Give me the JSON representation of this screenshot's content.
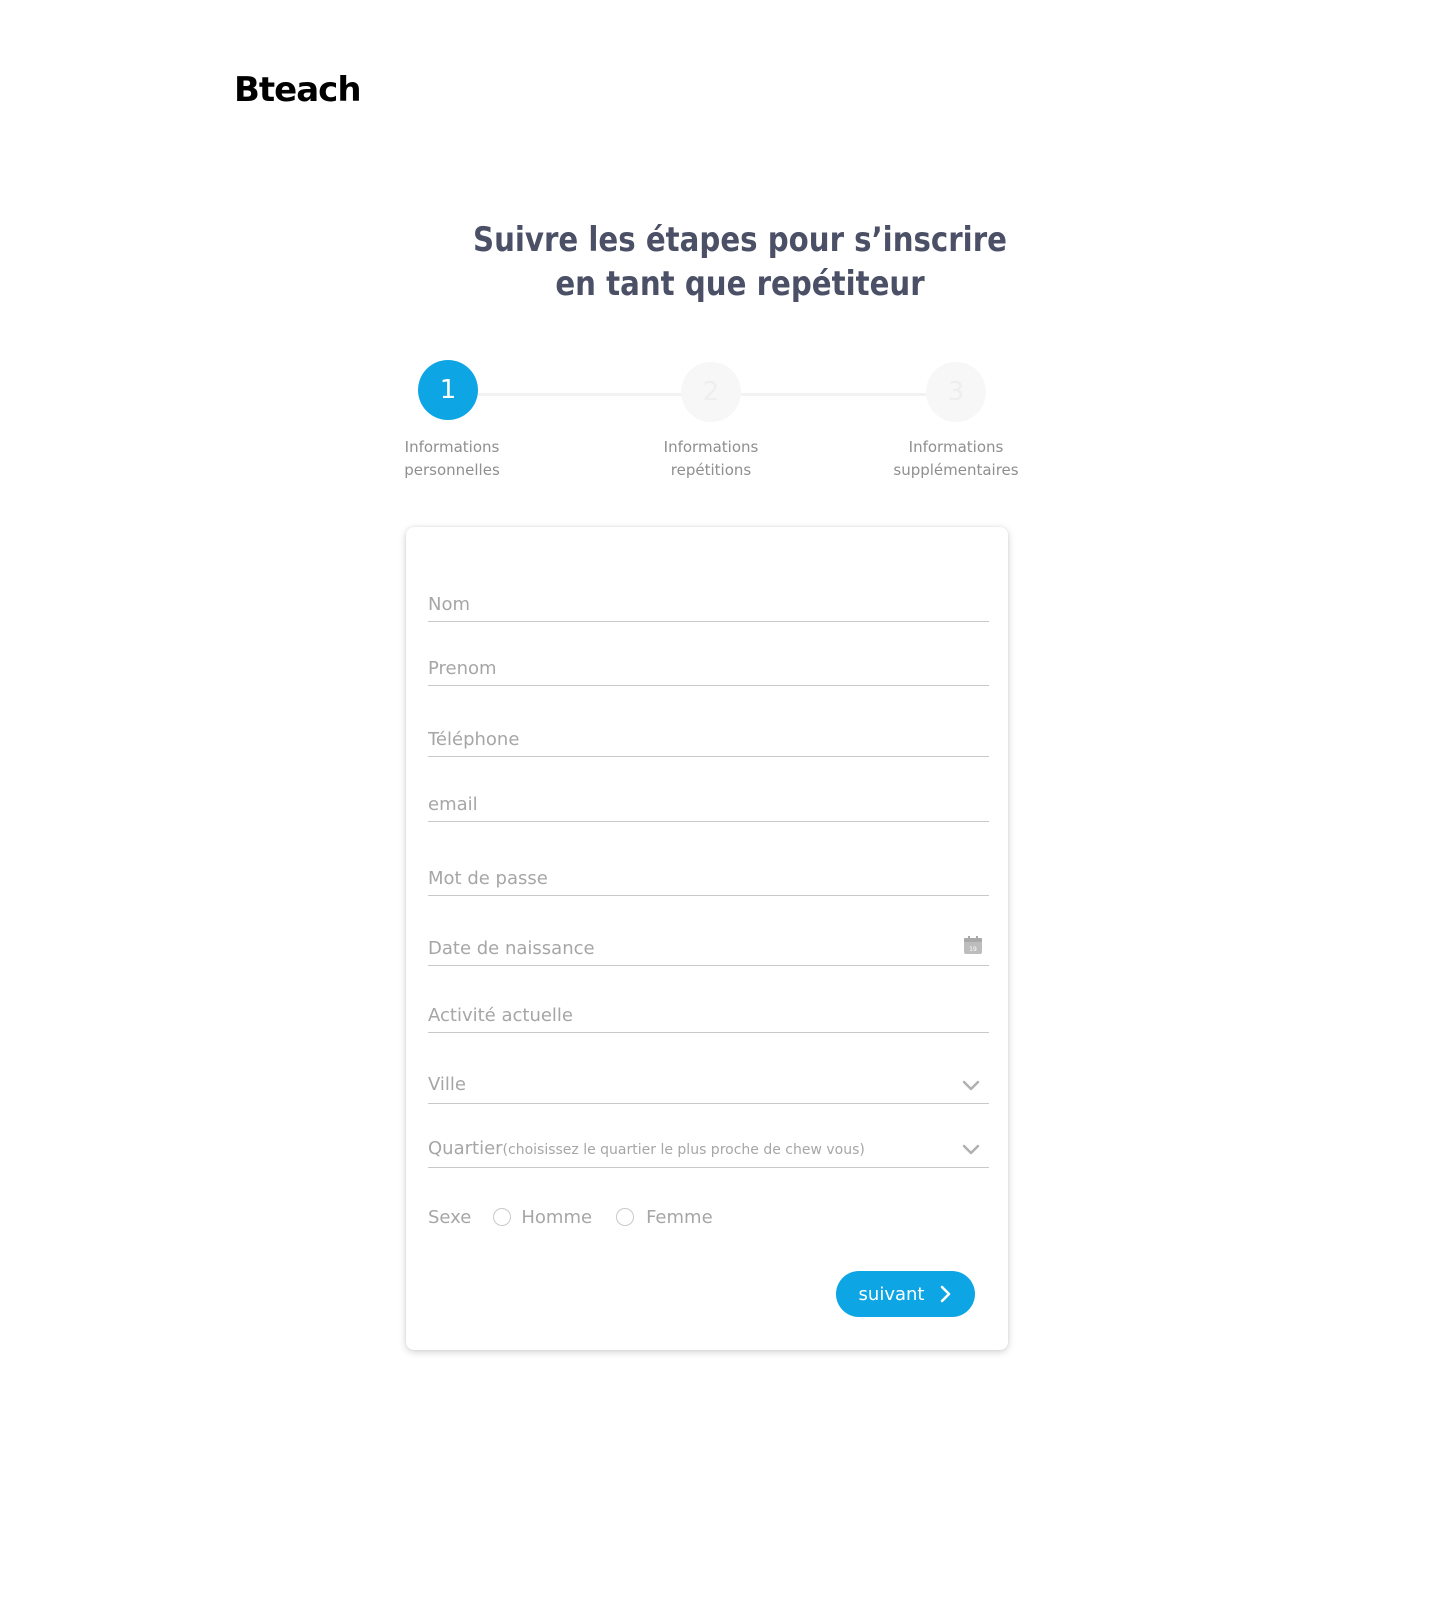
{
  "brand": {
    "logo_text": "Bteach"
  },
  "header": {
    "title_line1": "Suivre les étapes pour s’inscrire",
    "title_line2": "en tant que repétiteur"
  },
  "stepper": {
    "active_step": 1,
    "steps": [
      {
        "number": "1",
        "label_line1": "Informations",
        "label_line2": "personnelles"
      },
      {
        "number": "2",
        "label_line1": "Informations",
        "label_line2": "repétitions"
      },
      {
        "number": "3",
        "label_line1": "Informations",
        "label_line2": "supplémentaires"
      }
    ]
  },
  "form": {
    "nom": {
      "placeholder": "Nom",
      "value": ""
    },
    "prenom": {
      "placeholder": "Prenom",
      "value": ""
    },
    "telephone": {
      "placeholder": "Téléphone",
      "value": ""
    },
    "email": {
      "placeholder": "email",
      "value": ""
    },
    "mot_de_passe": {
      "placeholder": "Mot de passe",
      "value": ""
    },
    "date_naissance": {
      "placeholder": "Date de naissance",
      "value": "",
      "icon": "calendar-icon",
      "icon_text": "19"
    },
    "activite": {
      "placeholder": "Activité actuelle",
      "value": ""
    },
    "ville": {
      "placeholder": "Ville",
      "icon": "chevron-down-icon"
    },
    "quartier": {
      "placeholder": "Quartier",
      "hint": "(choisissez le quartier le plus proche de chew vous)",
      "icon": "chevron-down-icon"
    },
    "sexe": {
      "label": "Sexe",
      "options": [
        "Homme",
        "Femme"
      ]
    },
    "submit_label": "suivant"
  },
  "colors": {
    "accent": "#0ea5e4",
    "title": "#4b5066",
    "muted": "#a6a6a6",
    "inactive_step": "#f7f7f7"
  }
}
